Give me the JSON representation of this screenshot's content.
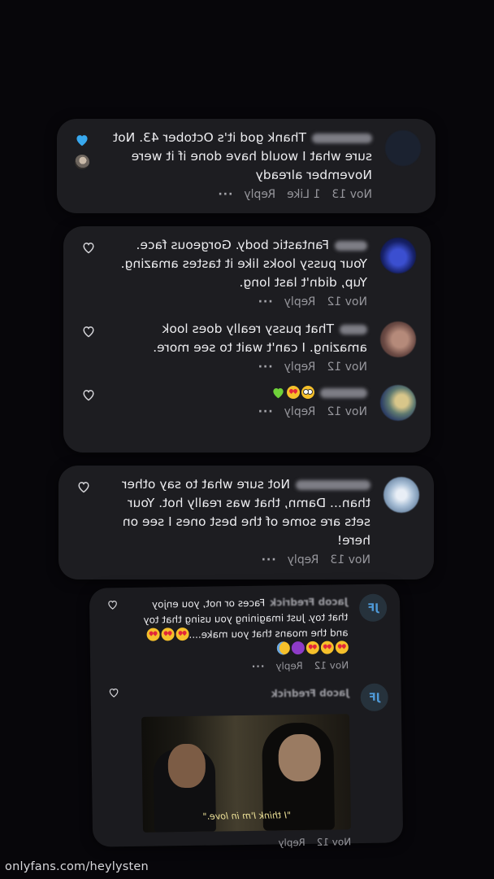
{
  "cards": [
    {
      "comments": [
        {
          "text": "Thank god it's October 43. Not sure what I would have done if it were November already",
          "date": "Nov 13",
          "likes": "1 Like",
          "reply": "Reply",
          "more": "···",
          "liked": true,
          "avatar_color": "#1b2230"
        }
      ]
    },
    {
      "comments": [
        {
          "text": "Fantastic body. Gorgeous face. Your pussy looks like it tastes amazing. Yup, didn't last long.",
          "date": "Nov 12",
          "reply": "Reply",
          "more": "···",
          "avatar_color": "#1c2a8a"
        },
        {
          "text": "That pussy really does look amazing. I can't wait to see more.",
          "date": "Nov 12",
          "reply": "Reply",
          "more": "···",
          "avatar_color": "#6b4a44"
        },
        {
          "text": "",
          "date": "Nov 12",
          "reply": "Reply",
          "more": "···",
          "avatar_color": "#5f7a70"
        }
      ]
    },
    {
      "comments": [
        {
          "text": "Not sure what to say other than... Damn, that was really hot. Your sets are some of the best ones I see on here!",
          "date": "Nov 13",
          "reply": "Reply",
          "more": "···",
          "avatar_color": "#a9bfd6"
        }
      ]
    },
    {
      "comments": [
        {
          "user": "Jacob Fredrick",
          "text": "Faces or not, you enjoy that toy. Just imagining you using that toy and the moans that you make....",
          "date": "Nov 12",
          "reply": "Reply",
          "more": "···",
          "avatar_text": "JF"
        },
        {
          "user": "Jacob Fredrick",
          "gif_caption": "\"I think I'm in love.\"",
          "date": "Nov 12",
          "reply": "Reply",
          "avatar_text": "JF"
        }
      ]
    }
  ],
  "watermark": "onlyfans.com/heylysten"
}
